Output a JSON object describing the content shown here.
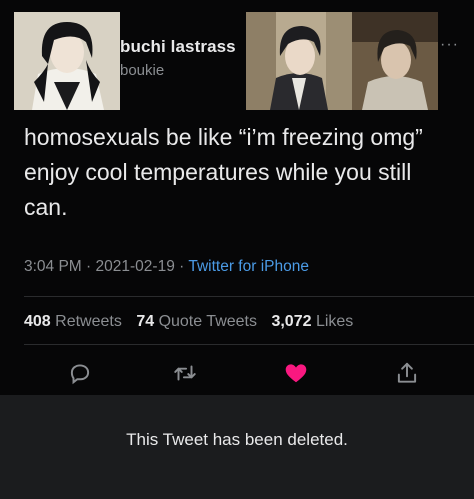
{
  "author": {
    "display_name": "buchi lastrass",
    "handle": "boukie",
    "avatar_icon": "profile-photo",
    "header_images": [
      "illustration-portrait-1",
      "illustration-portrait-2"
    ]
  },
  "menu": {
    "more_label": "···",
    "icon": "more-dots-icon"
  },
  "tweet": {
    "text": "homosexuals be like “i’m freezing omg” enjoy cool temperatures while you still can.",
    "time": "3:04 PM",
    "date": "2021-02-19",
    "separator": "·",
    "source": "Twitter for iPhone"
  },
  "stats": {
    "retweets_count": "408",
    "retweets_label": "Retweets",
    "quotes_count": "74",
    "quotes_label": "Quote Tweets",
    "likes_count": "3,072",
    "likes_label": "Likes"
  },
  "actions": [
    {
      "icon": "reply-icon"
    },
    {
      "icon": "retweet-icon"
    },
    {
      "icon": "heart-icon",
      "state": "liked",
      "color": "#f91880"
    },
    {
      "icon": "share-icon"
    }
  ],
  "notice": {
    "text": "This Tweet has been deleted."
  },
  "colors": {
    "background": "#060607",
    "text": "#e9e9ea",
    "muted": "#8b8e92",
    "link": "#4b9be6",
    "like": "#f91880",
    "notice_bg": "#1b1c1e"
  }
}
